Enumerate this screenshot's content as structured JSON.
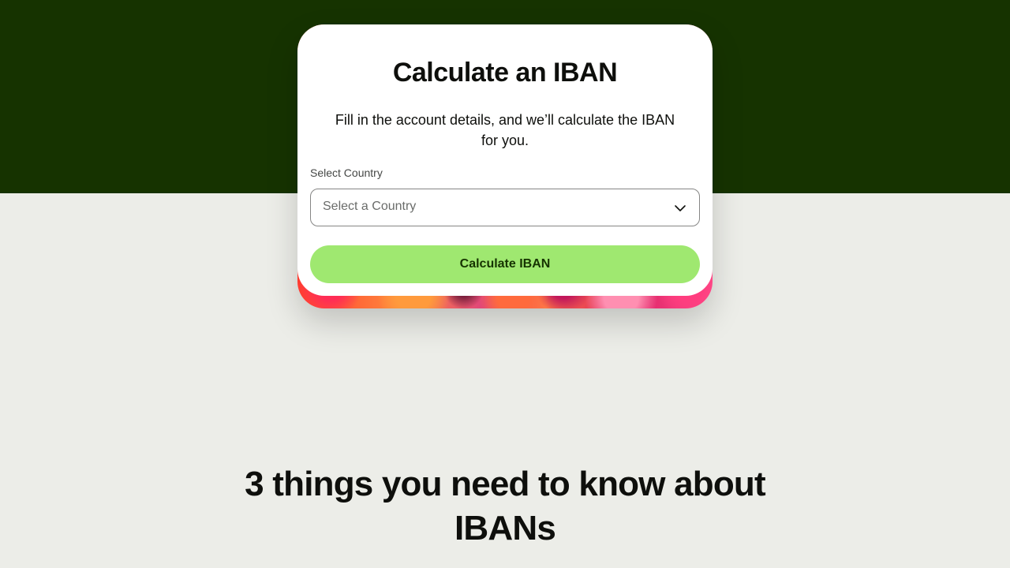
{
  "card": {
    "title": "Calculate an IBAN",
    "description": "Fill in the account details, and we’ll calculate the IBAN for you.",
    "country_label": "Select Country",
    "country_placeholder": "Select a Country",
    "submit_label": "Calculate IBAN"
  },
  "info_section": {
    "heading": "3 things you need to know about IBANs"
  },
  "colors": {
    "hero_background": "#163300",
    "page_background": "#ecede8",
    "button_background": "#9fe870",
    "button_text": "#163300"
  },
  "icons": {
    "select_chevron": "chevron-down-icon"
  }
}
